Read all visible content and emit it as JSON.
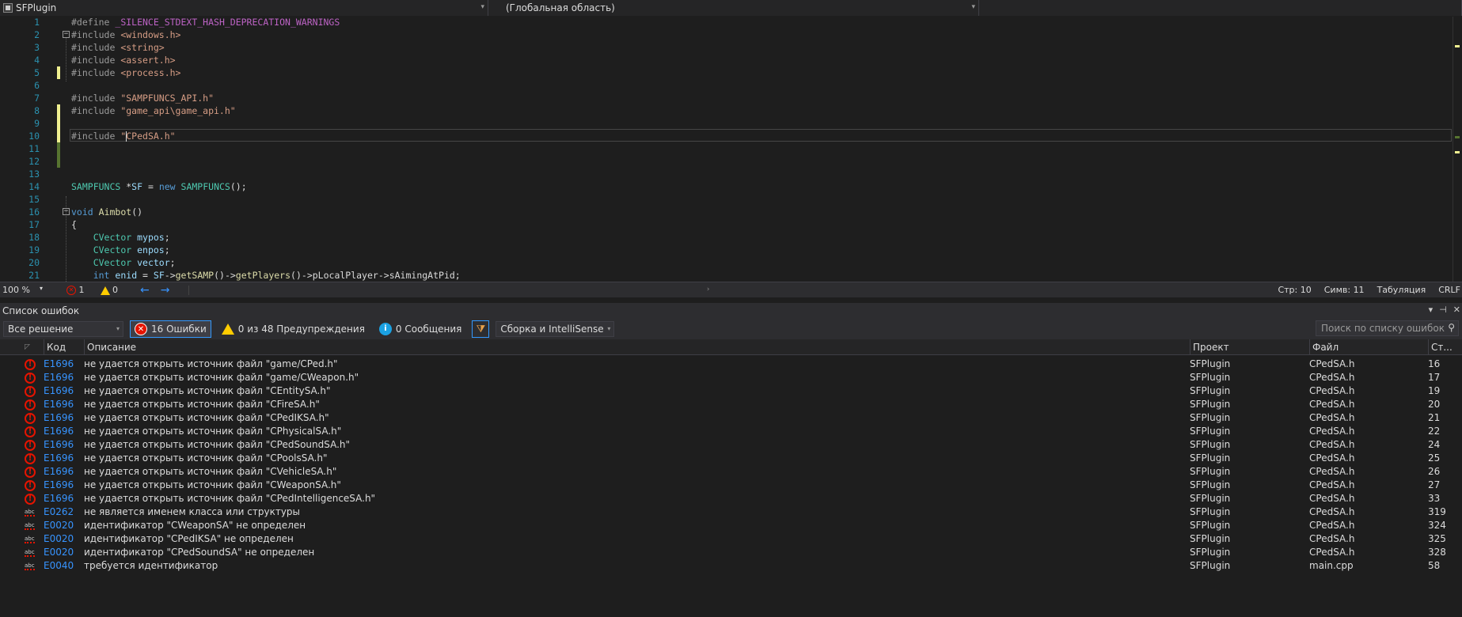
{
  "nav": {
    "project": "SFPlugin",
    "scope": "(Глобальная область)",
    "member": ""
  },
  "editor": {
    "lines": [
      {
        "n": "1",
        "parts": [
          [
            "pp",
            "#define "
          ],
          [
            "mac",
            "_SILENCE_STDEXT_HASH_DEPRECATION_WARNINGS"
          ]
        ]
      },
      {
        "n": "2",
        "parts": [
          [
            "pp",
            "#include "
          ],
          [
            "inc",
            "<windows.h>"
          ]
        ]
      },
      {
        "n": "3",
        "parts": [
          [
            "pp",
            "#include "
          ],
          [
            "inc",
            "<string>"
          ]
        ]
      },
      {
        "n": "4",
        "parts": [
          [
            "pp",
            "#include "
          ],
          [
            "inc",
            "<assert.h>"
          ]
        ]
      },
      {
        "n": "5",
        "parts": [
          [
            "pp",
            "#include "
          ],
          [
            "inc",
            "<process.h>"
          ]
        ]
      },
      {
        "n": "6",
        "parts": []
      },
      {
        "n": "7",
        "parts": [
          [
            "pp",
            "#include "
          ],
          [
            "inc",
            "\"SAMPFUNCS_API.h\""
          ]
        ]
      },
      {
        "n": "8",
        "parts": [
          [
            "pp",
            "#include "
          ],
          [
            "inc",
            "\"game_api\\game_api.h\""
          ]
        ]
      },
      {
        "n": "9",
        "parts": []
      },
      {
        "n": "10",
        "parts": [
          [
            "pp",
            "#include "
          ],
          [
            "inc",
            "\""
          ],
          [
            "caret",
            ""
          ],
          [
            "inc",
            "CPedSA.h\""
          ]
        ]
      },
      {
        "n": "11",
        "parts": []
      },
      {
        "n": "12",
        "parts": []
      },
      {
        "n": "13",
        "parts": []
      },
      {
        "n": "14",
        "parts": [
          [
            "ty",
            "SAMPFUNCS"
          ],
          [
            "txt",
            " *"
          ],
          [
            "var",
            "SF"
          ],
          [
            "txt",
            " = "
          ],
          [
            "kw",
            "new"
          ],
          [
            "txt",
            " "
          ],
          [
            "ty",
            "SAMPFUNCS"
          ],
          [
            "txt",
            "();"
          ]
        ]
      },
      {
        "n": "15",
        "parts": []
      },
      {
        "n": "16",
        "parts": [
          [
            "kw",
            "void"
          ],
          [
            "txt",
            " "
          ],
          [
            "fn",
            "Aimbot"
          ],
          [
            "txt",
            "()"
          ]
        ]
      },
      {
        "n": "17",
        "parts": [
          [
            "txt",
            "{"
          ]
        ]
      },
      {
        "n": "18",
        "parts": [
          [
            "txt",
            "    "
          ],
          [
            "ty",
            "CVector"
          ],
          [
            "txt",
            " "
          ],
          [
            "var",
            "mypos"
          ],
          [
            "txt",
            ";"
          ]
        ]
      },
      {
        "n": "19",
        "parts": [
          [
            "txt",
            "    "
          ],
          [
            "ty",
            "CVector"
          ],
          [
            "txt",
            " "
          ],
          [
            "var",
            "enpos"
          ],
          [
            "txt",
            ";"
          ]
        ]
      },
      {
        "n": "20",
        "parts": [
          [
            "txt",
            "    "
          ],
          [
            "ty",
            "CVector"
          ],
          [
            "txt",
            " "
          ],
          [
            "var",
            "vector"
          ],
          [
            "txt",
            ";"
          ]
        ]
      },
      {
        "n": "21",
        "parts": [
          [
            "txt",
            "    "
          ],
          [
            "kw",
            "int"
          ],
          [
            "txt",
            " "
          ],
          [
            "var",
            "enid"
          ],
          [
            "txt",
            " = "
          ],
          [
            "var",
            "SF"
          ],
          [
            "txt",
            "->"
          ],
          [
            "fn",
            "getSAMP"
          ],
          [
            "txt",
            "()->"
          ],
          [
            "fn",
            "getPlayers"
          ],
          [
            "txt",
            "()->"
          ],
          [
            "fld",
            "pLocalPlayer"
          ],
          [
            "txt",
            "->"
          ],
          [
            "fld",
            "sAimingAtPid"
          ],
          [
            "txt",
            ";"
          ]
        ]
      }
    ]
  },
  "status": {
    "zoom": "100 %",
    "errors": "1",
    "warnings": "0",
    "line": "Стр: 10",
    "col": "Симв: 11",
    "tabs": "Табуляция",
    "eol": "CRLF"
  },
  "errorlist": {
    "title": "Список ошибок",
    "scope": "Все решение",
    "errors_label": "16 Ошибки",
    "warnings_label": "0 из 48 Предупреждения",
    "messages_label": "0 Сообщения",
    "source": "Сборка и IntelliSense",
    "search_placeholder": "Поиск по списку ошибок",
    "columns": {
      "code": "Код",
      "desc": "Описание",
      "project": "Проект",
      "file": "Файл",
      "line": "Ст..."
    },
    "rows": [
      {
        "icon": "error",
        "code": "E1696",
        "desc": "не удается открыть источник файл \"game/CPed.h\"",
        "project": "SFPlugin",
        "file": "CPedSA.h",
        "line": "16"
      },
      {
        "icon": "error",
        "code": "E1696",
        "desc": "не удается открыть источник файл \"game/CWeapon.h\"",
        "project": "SFPlugin",
        "file": "CPedSA.h",
        "line": "17"
      },
      {
        "icon": "error",
        "code": "E1696",
        "desc": "не удается открыть источник файл \"CEntitySA.h\"",
        "project": "SFPlugin",
        "file": "CPedSA.h",
        "line": "19"
      },
      {
        "icon": "error",
        "code": "E1696",
        "desc": "не удается открыть источник файл \"CFireSA.h\"",
        "project": "SFPlugin",
        "file": "CPedSA.h",
        "line": "20"
      },
      {
        "icon": "error",
        "code": "E1696",
        "desc": "не удается открыть источник файл \"CPedIKSA.h\"",
        "project": "SFPlugin",
        "file": "CPedSA.h",
        "line": "21"
      },
      {
        "icon": "error",
        "code": "E1696",
        "desc": "не удается открыть источник файл \"CPhysicalSA.h\"",
        "project": "SFPlugin",
        "file": "CPedSA.h",
        "line": "22"
      },
      {
        "icon": "error",
        "code": "E1696",
        "desc": "не удается открыть источник файл \"CPedSoundSA.h\"",
        "project": "SFPlugin",
        "file": "CPedSA.h",
        "line": "24"
      },
      {
        "icon": "error",
        "code": "E1696",
        "desc": "не удается открыть источник файл \"CPoolsSA.h\"",
        "project": "SFPlugin",
        "file": "CPedSA.h",
        "line": "25"
      },
      {
        "icon": "error",
        "code": "E1696",
        "desc": "не удается открыть источник файл \"CVehicleSA.h\"",
        "project": "SFPlugin",
        "file": "CPedSA.h",
        "line": "26"
      },
      {
        "icon": "error",
        "code": "E1696",
        "desc": "не удается открыть источник файл \"CWeaponSA.h\"",
        "project": "SFPlugin",
        "file": "CPedSA.h",
        "line": "27"
      },
      {
        "icon": "error",
        "code": "E1696",
        "desc": "не удается открыть источник файл \"CPedIntelligenceSA.h\"",
        "project": "SFPlugin",
        "file": "CPedSA.h",
        "line": "33"
      },
      {
        "icon": "abc",
        "code": "E0262",
        "desc": "не является именем класса или структуры",
        "project": "SFPlugin",
        "file": "CPedSA.h",
        "line": "319"
      },
      {
        "icon": "abc",
        "code": "E0020",
        "desc": "идентификатор \"CWeaponSA\" не определен",
        "project": "SFPlugin",
        "file": "CPedSA.h",
        "line": "324"
      },
      {
        "icon": "abc",
        "code": "E0020",
        "desc": "идентификатор \"CPedIKSA\" не определен",
        "project": "SFPlugin",
        "file": "CPedSA.h",
        "line": "325"
      },
      {
        "icon": "abc",
        "code": "E0020",
        "desc": "идентификатор \"CPedSoundSA\" не определен",
        "project": "SFPlugin",
        "file": "CPedSA.h",
        "line": "328"
      },
      {
        "icon": "abc",
        "code": "E0040",
        "desc": "требуется идентификатор",
        "project": "SFPlugin",
        "file": "main.cpp",
        "line": "58"
      }
    ]
  }
}
